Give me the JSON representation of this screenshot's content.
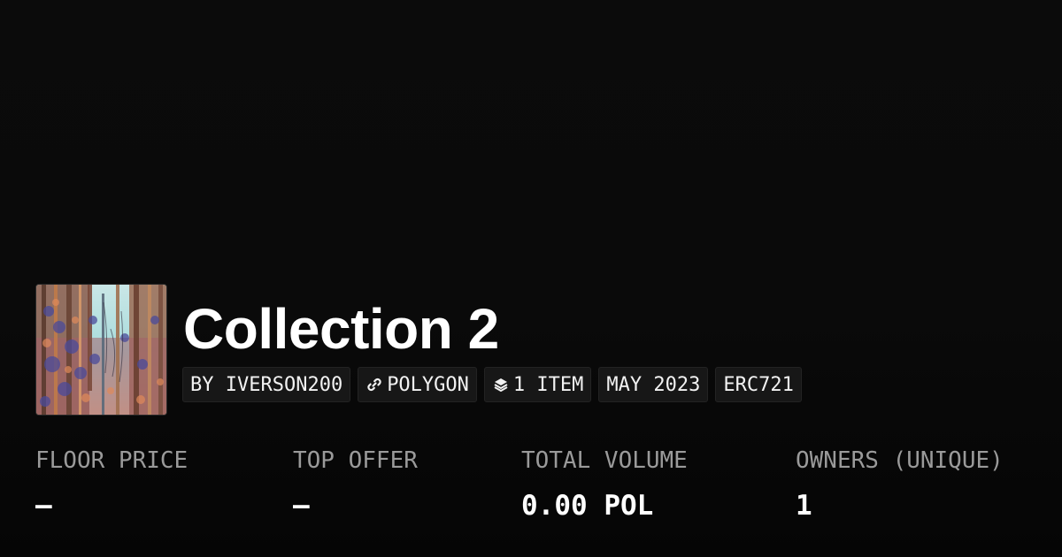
{
  "collection": {
    "title": "Collection 2",
    "thumbnail_icon": "collection-artwork"
  },
  "chips": {
    "creator": "BY IVERSON200",
    "chain_icon": "link-icon",
    "chain": "POLYGON",
    "items_icon": "layers-icon",
    "items": "1 ITEM",
    "date": "MAY 2023",
    "standard": "ERC721"
  },
  "stats": [
    {
      "label": "FLOOR PRICE",
      "value": "–"
    },
    {
      "label": "TOP OFFER",
      "value": "–"
    },
    {
      "label": "TOTAL VOLUME",
      "value": "0.00 POL"
    },
    {
      "label": "OWNERS (UNIQUE)",
      "value": "1"
    }
  ]
}
